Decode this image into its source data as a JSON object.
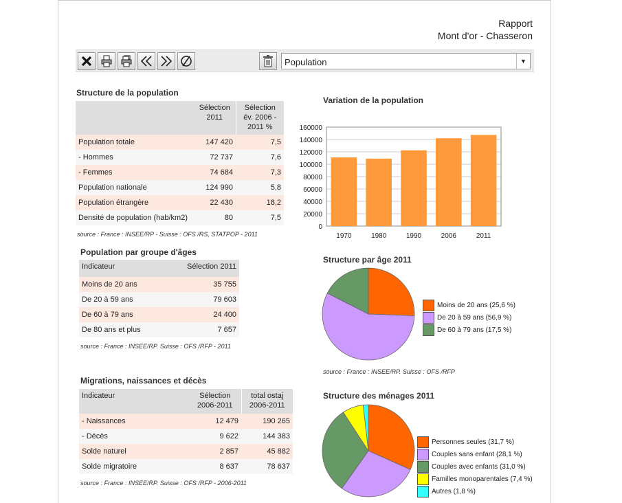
{
  "header": {
    "line1": "Rapport",
    "line2": "Mont d'or - Chasseron"
  },
  "toolbar": {
    "buttons": [
      "close-icon",
      "print-icon",
      "print-all-icon",
      "previous-icon",
      "next-icon",
      "clear-icon"
    ],
    "trash": "trash-icon",
    "select_value": "Population"
  },
  "structure": {
    "title": "Structure de la population",
    "headers": [
      "",
      "Sélection\n2011",
      "Sélection\név. 2006 -\n2011 %"
    ],
    "rows": [
      [
        "Population totale",
        "147 420",
        "7,5"
      ],
      [
        "- Hommes",
        "72 737",
        "7,6"
      ],
      [
        "- Femmes",
        "74 684",
        "7,3"
      ],
      [
        "Population nationale",
        "124 990",
        "5,8"
      ],
      [
        "Population étrangère",
        "22 430",
        "18,2"
      ],
      [
        "Densité de population (hab/km2)",
        "80",
        "7,5"
      ]
    ],
    "source": "source : France : INSEE/RP  - Suisse : OFS /RS, STATPOP - 2011"
  },
  "ages": {
    "title": "Population par groupe d'âges",
    "headers": [
      "Indicateur",
      "Sélection 2011"
    ],
    "rows": [
      [
        "Moins de 20 ans",
        "35 755"
      ],
      [
        "De 20 à 59 ans",
        "79 603"
      ],
      [
        "De 60 à 79 ans",
        "24 400"
      ],
      [
        "De 80 ans et plus",
        "7 657"
      ]
    ],
    "source": "source : France : INSEE/RP.  Suisse : OFS /RFP - 2011"
  },
  "migrations": {
    "title": "Migrations, naissances et décès",
    "headers": [
      "Indicateur",
      "Sélection\n2006-2011",
      "total ostaj\n2006-2011"
    ],
    "rows": [
      [
        "-    Naissances",
        "12 479",
        "190 265"
      ],
      [
        "-    Décès",
        "9 622",
        "144 383"
      ],
      [
        "Solde naturel",
        "2 857",
        "45 882"
      ],
      [
        "Solde migratoire",
        "8 637",
        "78 637"
      ]
    ],
    "source": "source : France : INSEE/RP.  Suisse : OFS /RFP - 2006-2011"
  },
  "chart_data": [
    {
      "type": "bar",
      "title": "Variation de la population",
      "categories": [
        "1970",
        "1980",
        "1990",
        "2006",
        "2011"
      ],
      "values": [
        111000,
        109000,
        122500,
        142000,
        147420
      ],
      "ylim": [
        0,
        160000
      ],
      "yticks": [
        "0",
        "20000",
        "40000",
        "60000",
        "80000",
        "100000",
        "120000",
        "140000",
        "160000"
      ],
      "color": "#ff9a3c",
      "grid": true
    },
    {
      "type": "pie",
      "title": "Structure par âge 2011",
      "labels": [
        "Moins de 20 ans (25,6 %)",
        "De 20 à 59 ans (56,9 %)",
        "De 60 à 79 ans (17,5 %)"
      ],
      "values": [
        25.6,
        56.9,
        17.5
      ],
      "colors": [
        "#ff6600",
        "#cc99ff",
        "#669966"
      ],
      "source": "source : France : INSEE/RP.  Suisse : OFS /RFP"
    },
    {
      "type": "pie",
      "title": "Structure des ménages 2011",
      "labels": [
        "Personnes seules (31,7 %)",
        "Couples sans enfant (28,1 %)",
        "Couples avec enfants (31,0 %)",
        "Familles monoparentales (7,4 %)",
        "Autres (1,8 %)"
      ],
      "values": [
        31.7,
        28.1,
        31.0,
        7.4,
        1.8
      ],
      "colors": [
        "#ff6600",
        "#cc99ff",
        "#669966",
        "#ffff00",
        "#33ffff"
      ]
    }
  ]
}
